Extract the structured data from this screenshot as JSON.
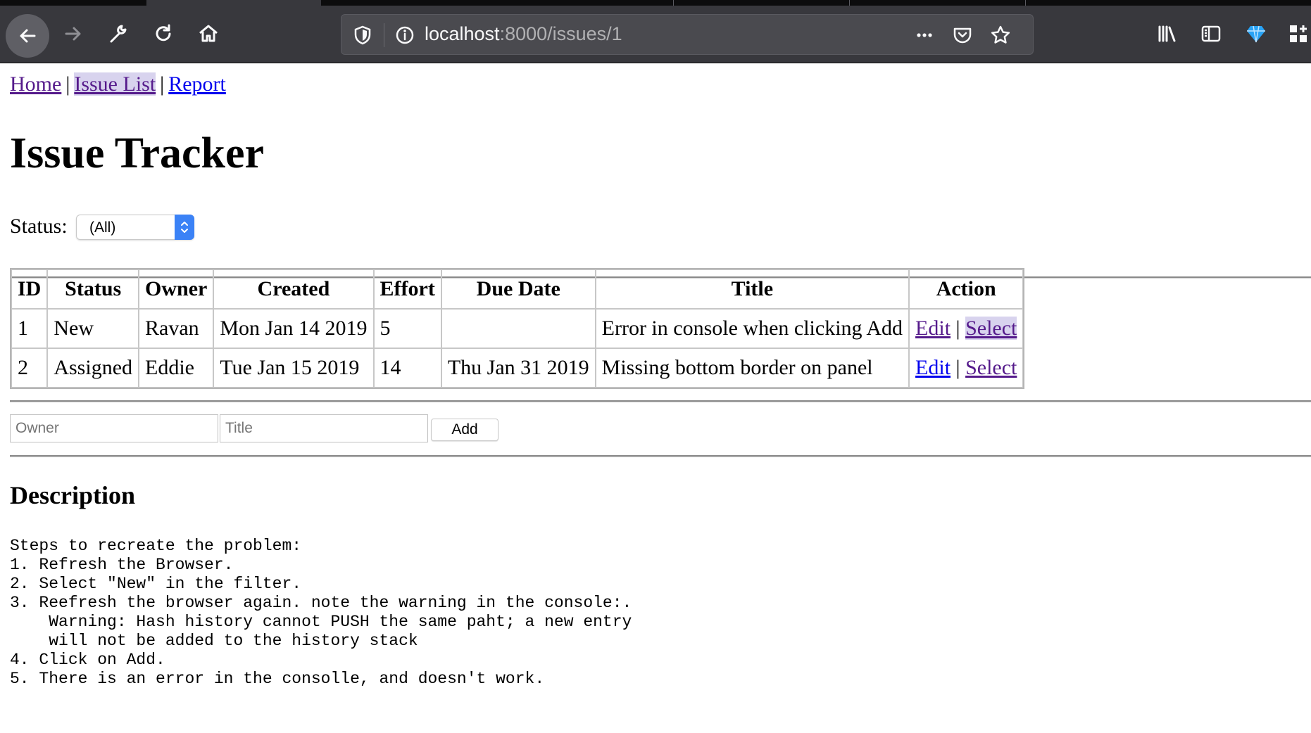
{
  "browser": {
    "url_host": "localhost",
    "url_path": ":8000/issues/1"
  },
  "nav": {
    "home": "Home",
    "issue_list": "Issue List",
    "report": "Report",
    "separator": "|"
  },
  "page_title": "Issue Tracker",
  "filter": {
    "label": "Status:",
    "selected": "(All)"
  },
  "table": {
    "headers": [
      "ID",
      "Status",
      "Owner",
      "Created",
      "Effort",
      "Due Date",
      "Title",
      "Action"
    ],
    "rows": [
      {
        "id": "1",
        "status": "New",
        "owner": "Ravan",
        "created": "Mon Jan 14 2019",
        "effort": "5",
        "due": "",
        "title": "Error in console when clicking Add",
        "edit": "Edit",
        "sep": "|",
        "select": "Select"
      },
      {
        "id": "2",
        "status": "Assigned",
        "owner": "Eddie",
        "created": "Tue Jan 15 2019",
        "effort": "14",
        "due": "Thu Jan 31 2019",
        "title": "Missing bottom border on panel",
        "edit": "Edit",
        "sep": "|",
        "select": "Select"
      }
    ]
  },
  "add_form": {
    "owner_placeholder": "Owner",
    "title_placeholder": "Title",
    "add_label": "Add"
  },
  "description": {
    "heading": "Description",
    "text": "Steps to recreate the problem:\n1. Refresh the Browser.\n2. Select \"New\" in the filter.\n3. Reefresh the browser again. note the warning in the console:.\n    Warning: Hash history cannot PUSH the same paht; a new entry\n    will not be added to the history stack\n4. Click on Add.\n5. There is an error in the consolle, and doesn't work."
  },
  "icons": {
    "back": "back-arrow-icon",
    "forward": "forward-arrow-icon",
    "tools": "wrench-icon",
    "reload": "reload-icon",
    "home": "home-icon",
    "shield": "tracking-shield-icon",
    "info": "info-icon",
    "more": "ellipsis-icon",
    "pocket": "pocket-icon",
    "bookmark": "star-icon",
    "library": "library-icon",
    "sidebar": "sidebar-icon",
    "extension": "gem-icon",
    "overflow": "extensions-grid-icon"
  }
}
